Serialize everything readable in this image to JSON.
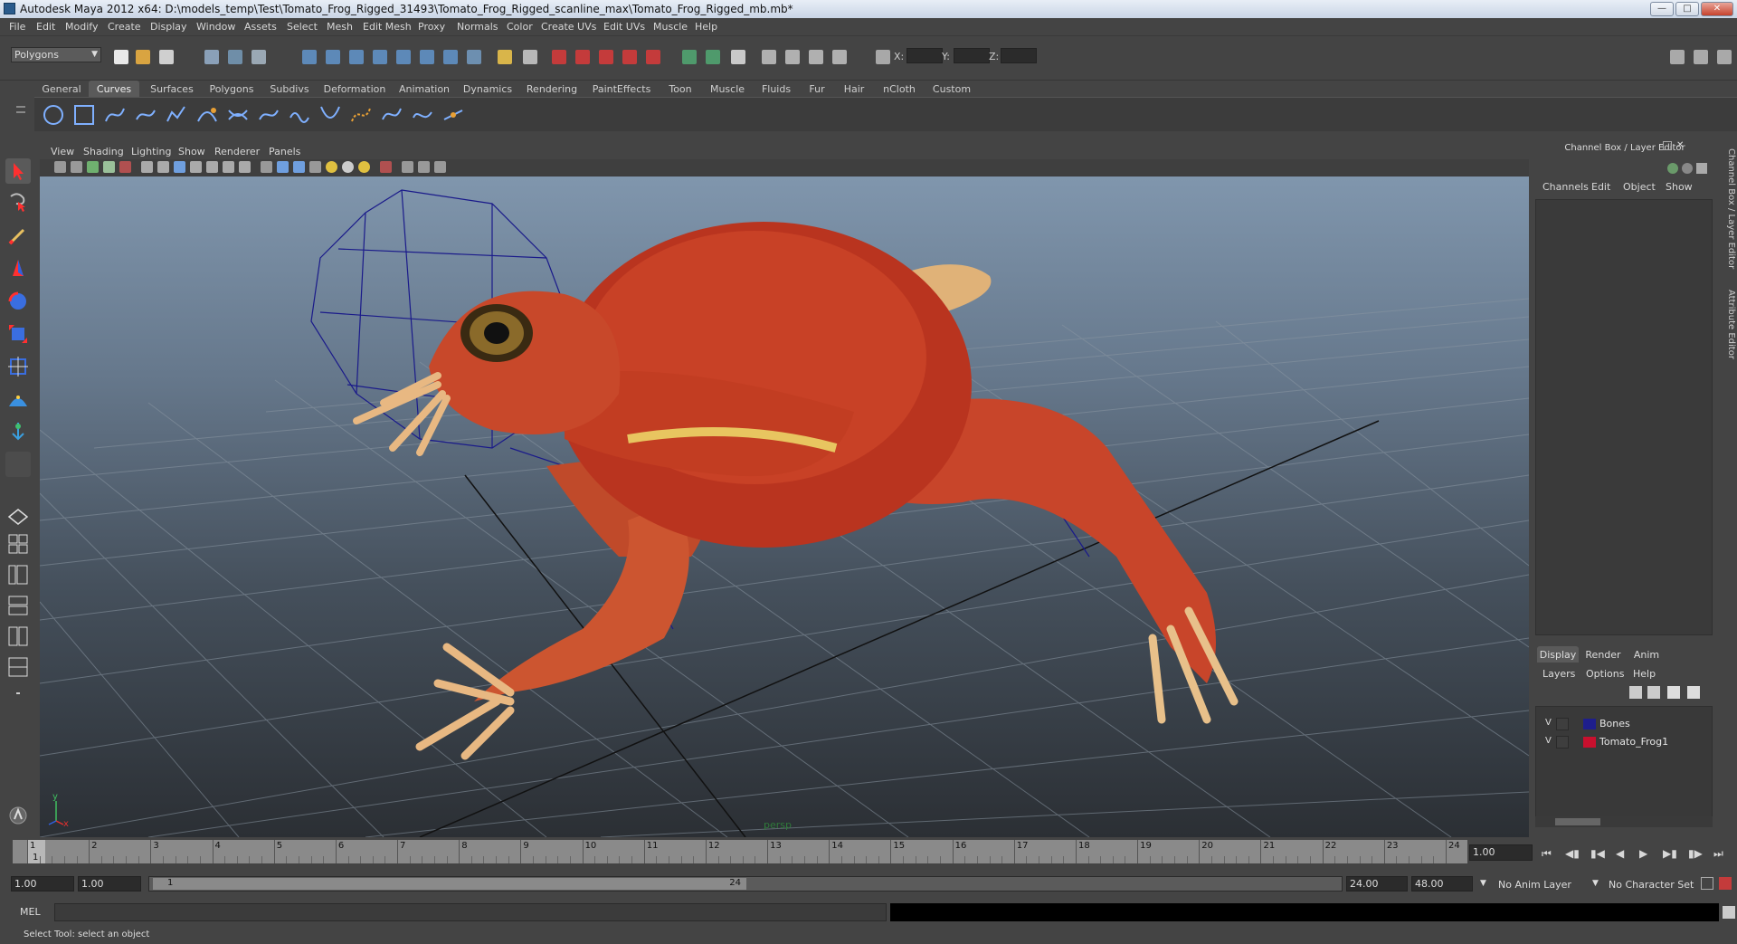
{
  "window": {
    "title": "Autodesk Maya 2012 x64: D:\\models_temp\\Test\\Tomato_Frog_Rigged_31493\\Tomato_Frog_Rigged_scanline_max\\Tomato_Frog_Rigged_mb.mb*"
  },
  "menubar": [
    "File",
    "Edit",
    "Modify",
    "Create",
    "Display",
    "Window",
    "Assets",
    "Select",
    "Mesh",
    "Edit Mesh",
    "Proxy",
    "Normals",
    "Color",
    "Create UVs",
    "Edit UVs",
    "Muscle",
    "Help"
  ],
  "statusline": {
    "menu_set": "Polygons",
    "x_label": "X:",
    "y_label": "Y:",
    "z_label": "Z:"
  },
  "shelf": {
    "tabs": [
      "General",
      "Curves",
      "Surfaces",
      "Polygons",
      "Subdivs",
      "Deformation",
      "Animation",
      "Dynamics",
      "Rendering",
      "PaintEffects",
      "Toon",
      "Muscle",
      "Fluids",
      "Fur",
      "Hair",
      "nCloth",
      "Custom"
    ],
    "active_tab": "Curves"
  },
  "viewport": {
    "menus": [
      "View",
      "Shading",
      "Lighting",
      "Show",
      "Renderer",
      "Panels"
    ],
    "camera_label": "persp",
    "axis_y": "y",
    "axis_x": "x"
  },
  "channel_box": {
    "title": "Channel Box / Layer Editor",
    "menus": [
      "Channels",
      "Edit",
      "Object",
      "Show"
    ]
  },
  "layer_editor": {
    "tabs": [
      "Display",
      "Render",
      "Anim"
    ],
    "active_tab": "Display",
    "menus": [
      "Layers",
      "Options",
      "Help"
    ],
    "layers": [
      {
        "visible": "V",
        "name": "Bones",
        "color": "#1e1e8c"
      },
      {
        "visible": "V",
        "name": "Tomato_Frog1",
        "color": "#c8102e"
      }
    ]
  },
  "side_tabs": [
    "Channel Box / Layer Editor",
    "Attribute Editor"
  ],
  "timeline": {
    "ticks": [
      "1",
      "2",
      "3",
      "4",
      "5",
      "6",
      "7",
      "8",
      "9",
      "10",
      "11",
      "12",
      "13",
      "14",
      "15",
      "16",
      "17",
      "18",
      "19",
      "20",
      "21",
      "22",
      "23",
      "24"
    ],
    "current_frame_marker": "1",
    "current_time": "1.00"
  },
  "range_slider": {
    "start_time": "1.00",
    "playback_start": "1.00",
    "range_start": "1",
    "range_end": "24",
    "playback_end": "24.00",
    "end_time": "48.00",
    "anim_layer": "No Anim Layer",
    "character_set": "No Character Set"
  },
  "command_line": {
    "language": "MEL"
  },
  "help_line": {
    "text": "Select Tool: select an object"
  }
}
